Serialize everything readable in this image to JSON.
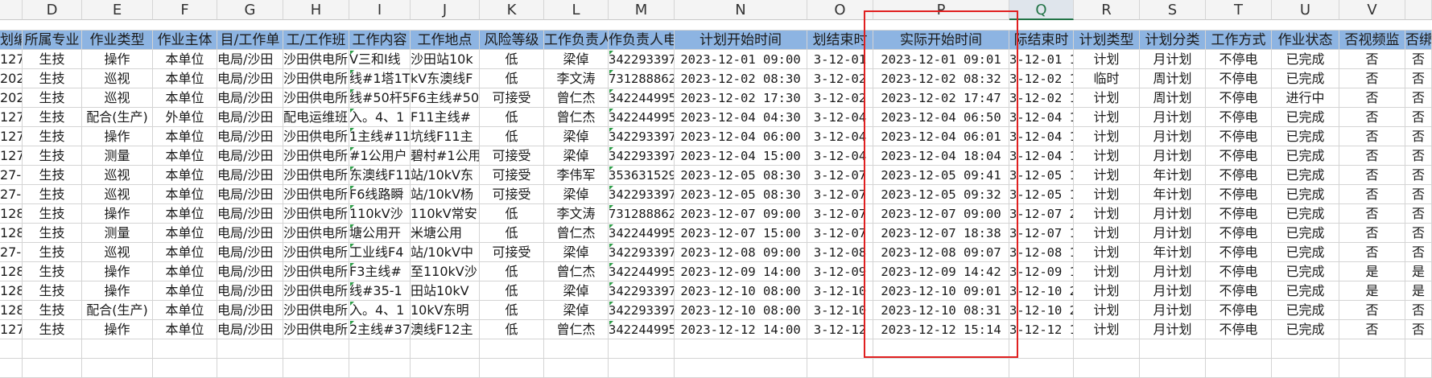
{
  "colors": {
    "header_fill": "#8db4e2",
    "highlight_box": "#e02020",
    "selected_column": "#217346"
  },
  "column_letters": [
    "",
    "D",
    "E",
    "F",
    "G",
    "H",
    "I",
    "J",
    "K",
    "L",
    "M",
    "N",
    "O",
    "P",
    "Q",
    "R",
    "S",
    "T",
    "U",
    "V",
    ""
  ],
  "selected_column": "Q",
  "header_row": [
    "划编",
    "所属专业",
    "作业类型",
    "作业主体",
    "目/工作单",
    "工/工作班",
    "工作内容",
    "工作地点",
    "风险等级",
    "工作负责人",
    "作负责人电",
    "计划开始时间",
    "划结束时",
    "实际开始时间",
    "际结束时",
    "计划类型",
    "计划分类",
    "工作方式",
    "作业状态",
    "否视频监",
    "否绑"
  ],
  "rows": [
    [
      "127",
      "生技",
      "操作",
      "本单位",
      "电局/沙田",
      "沙田供电所",
      "V三和I线",
      "沙田站10k",
      "低",
      "梁倬",
      "342293397",
      "2023-12-01 09:00",
      "3-12-01",
      "2023-12-01 09:01",
      "3-12-01 1",
      "计划",
      "月计划",
      "不停电",
      "已完成",
      "否",
      "否"
    ],
    [
      "202",
      "生技",
      "巡视",
      "本单位",
      "电局/沙田",
      "沙田供电所",
      "线#1塔1T",
      "kV东澳线F",
      "低",
      "李文涛",
      "731288862",
      "2023-12-02 08:30",
      "3-12-02",
      "2023-12-02 08:32",
      "3-12-02 1",
      "临时",
      "周计划",
      "不停电",
      "已完成",
      "否",
      "否"
    ],
    [
      "202",
      "生技",
      "巡视",
      "本单位",
      "电局/沙田",
      "沙田供电所",
      "线#50杆50",
      "F6主线#50",
      "可接受",
      "曾仁杰",
      "342244995",
      "2023-12-02 17:30",
      "3-12-02",
      "2023-12-02 17:47",
      "3-12-02 1",
      "计划",
      "周计划",
      "不停电",
      "进行中",
      "否",
      "否"
    ],
    [
      "127",
      "生技",
      "配合(生产)",
      "外单位",
      "电局/沙田",
      "配电运维班",
      "入。4、1",
      "F11主线#",
      "低",
      "曾仁杰",
      "342244995",
      "2023-12-04 04:30",
      "3-12-04",
      "2023-12-04 06:50",
      "3-12-04 1",
      "计划",
      "月计划",
      "不停电",
      "已完成",
      "否",
      "否"
    ],
    [
      "127",
      "生技",
      "操作",
      "本单位",
      "电局/沙田",
      "沙田供电所",
      "1主线#117",
      "坑线F11主",
      "低",
      "梁倬",
      "342293397",
      "2023-12-04 06:00",
      "3-12-04",
      "2023-12-04 06:01",
      "3-12-04 1",
      "计划",
      "月计划",
      "不停电",
      "已完成",
      "否",
      "否"
    ],
    [
      "127",
      "生技",
      "测量",
      "本单位",
      "电局/沙田",
      "沙田供电所",
      "#1公用户",
      "碧村#1公用",
      "可接受",
      "梁倬",
      "342293397",
      "2023-12-04 15:00",
      "3-12-04",
      "2023-12-04 18:04",
      "3-12-04 1",
      "计划",
      "月计划",
      "不停电",
      "已完成",
      "否",
      "否"
    ],
    [
      "27-",
      "生技",
      "巡视",
      "本单位",
      "电局/沙田",
      "沙田供电所",
      "东澳线F11",
      "站/10kV东",
      "可接受",
      "李伟军",
      "353631529",
      "2023-12-05 08:30",
      "3-12-07",
      "2023-12-05 09:41",
      "3-12-05 1",
      "计划",
      "年计划",
      "不停电",
      "已完成",
      "否",
      "否"
    ],
    [
      "27-",
      "生技",
      "巡视",
      "本单位",
      "电局/沙田",
      "沙田供电所",
      "F6线路瞬",
      "站/10kV杨",
      "可接受",
      "梁倬",
      "342293397",
      "2023-12-05 08:30",
      "3-12-07",
      "2023-12-05 09:32",
      "3-12-05 1",
      "计划",
      "年计划",
      "不停电",
      "已完成",
      "否",
      "否"
    ],
    [
      "128",
      "生技",
      "操作",
      "本单位",
      "电局/沙田",
      "沙田供电所",
      "110kV沙",
      "110kV常安",
      "低",
      "李文涛",
      "731288862",
      "2023-12-07 09:00",
      "3-12-07",
      "2023-12-07 09:00",
      "3-12-07 2",
      "计划",
      "月计划",
      "不停电",
      "已完成",
      "否",
      "否"
    ],
    [
      "128",
      "生技",
      "测量",
      "本单位",
      "电局/沙田",
      "沙田供电所",
      "塘公用开",
      "米塘公用",
      "低",
      "曾仁杰",
      "342244995",
      "2023-12-07 15:00",
      "3-12-07",
      "2023-12-07 18:38",
      "3-12-07 1",
      "计划",
      "月计划",
      "不停电",
      "已完成",
      "否",
      "否"
    ],
    [
      "27-",
      "生技",
      "巡视",
      "本单位",
      "电局/沙田",
      "沙田供电所",
      "工业线F4",
      "站/10kV中",
      "可接受",
      "梁倬",
      "342293397",
      "2023-12-08 09:00",
      "3-12-08",
      "2023-12-08 09:07",
      "3-12-08 1",
      "计划",
      "年计划",
      "不停电",
      "已完成",
      "否",
      "否"
    ],
    [
      "128",
      "生技",
      "操作",
      "本单位",
      "电局/沙田",
      "沙田供电所",
      "F3主线#",
      "至110kV沙",
      "低",
      "曾仁杰",
      "342244995",
      "2023-12-09 14:00",
      "3-12-09",
      "2023-12-09 14:42",
      "3-12-09 1",
      "计划",
      "月计划",
      "不停电",
      "已完成",
      "是",
      "是"
    ],
    [
      "128",
      "生技",
      "操作",
      "本单位",
      "电局/沙田",
      "沙田供电所",
      "线#35-1",
      "田站10kV",
      "低",
      "梁倬",
      "342293397",
      "2023-12-10 08:00",
      "3-12-10",
      "2023-12-10 09:01",
      "3-12-10 2",
      "计划",
      "月计划",
      "不停电",
      "已完成",
      "是",
      "是"
    ],
    [
      "128",
      "生技",
      "配合(生产)",
      "本单位",
      "电局/沙田",
      "沙田供电所",
      "入。4、1",
      "10kV东明",
      "低",
      "梁倬",
      "342293397",
      "2023-12-10 08:00",
      "3-12-10",
      "2023-12-10 08:31",
      "3-12-10 2",
      "计划",
      "月计划",
      "不停电",
      "已完成",
      "否",
      "否"
    ],
    [
      "127",
      "生技",
      "操作",
      "本单位",
      "电局/沙田",
      "沙田供电所",
      "2主线#37",
      "澳线F12主",
      "低",
      "曾仁杰",
      "342244995",
      "2023-12-12 14:00",
      "3-12-12",
      "2023-12-12 15:14",
      "3-12-12 1",
      "计划",
      "月计划",
      "不停电",
      "已完成",
      "否",
      "否"
    ]
  ]
}
